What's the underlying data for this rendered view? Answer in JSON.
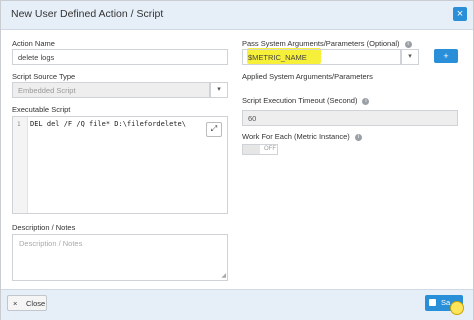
{
  "window": {
    "title": "New User Defined Action / Script"
  },
  "left": {
    "action_name_label": "Action Name",
    "action_name_value": "delete logs",
    "source_type_label": "Script Source Type",
    "source_type_value": "Embedded Script",
    "executable_label": "Executable Script",
    "code_line_number": "1",
    "code_text": "DEL del /F /Q file* D:\\filefordelete\\",
    "notes_label": "Description / Notes",
    "notes_placeholder": "Description / Notes"
  },
  "right": {
    "pass_args_label": "Pass System Arguments/Parameters (Optional)",
    "pass_args_value": "$METRIC_NAME",
    "add_button": "+",
    "applied_label": "Applied System Arguments/Parameters",
    "timeout_label": "Script Execution Timeout (Second)",
    "timeout_value": "60",
    "work_each_label": "Work For Each (Metric Instance)",
    "toggle_state": "OFF"
  },
  "footer": {
    "close_label": "Close",
    "save_label": "Sa"
  },
  "colors": {
    "accent": "#2a8fd9",
    "highlight": "#f7f03a",
    "header_bg": "#e6eef8"
  }
}
